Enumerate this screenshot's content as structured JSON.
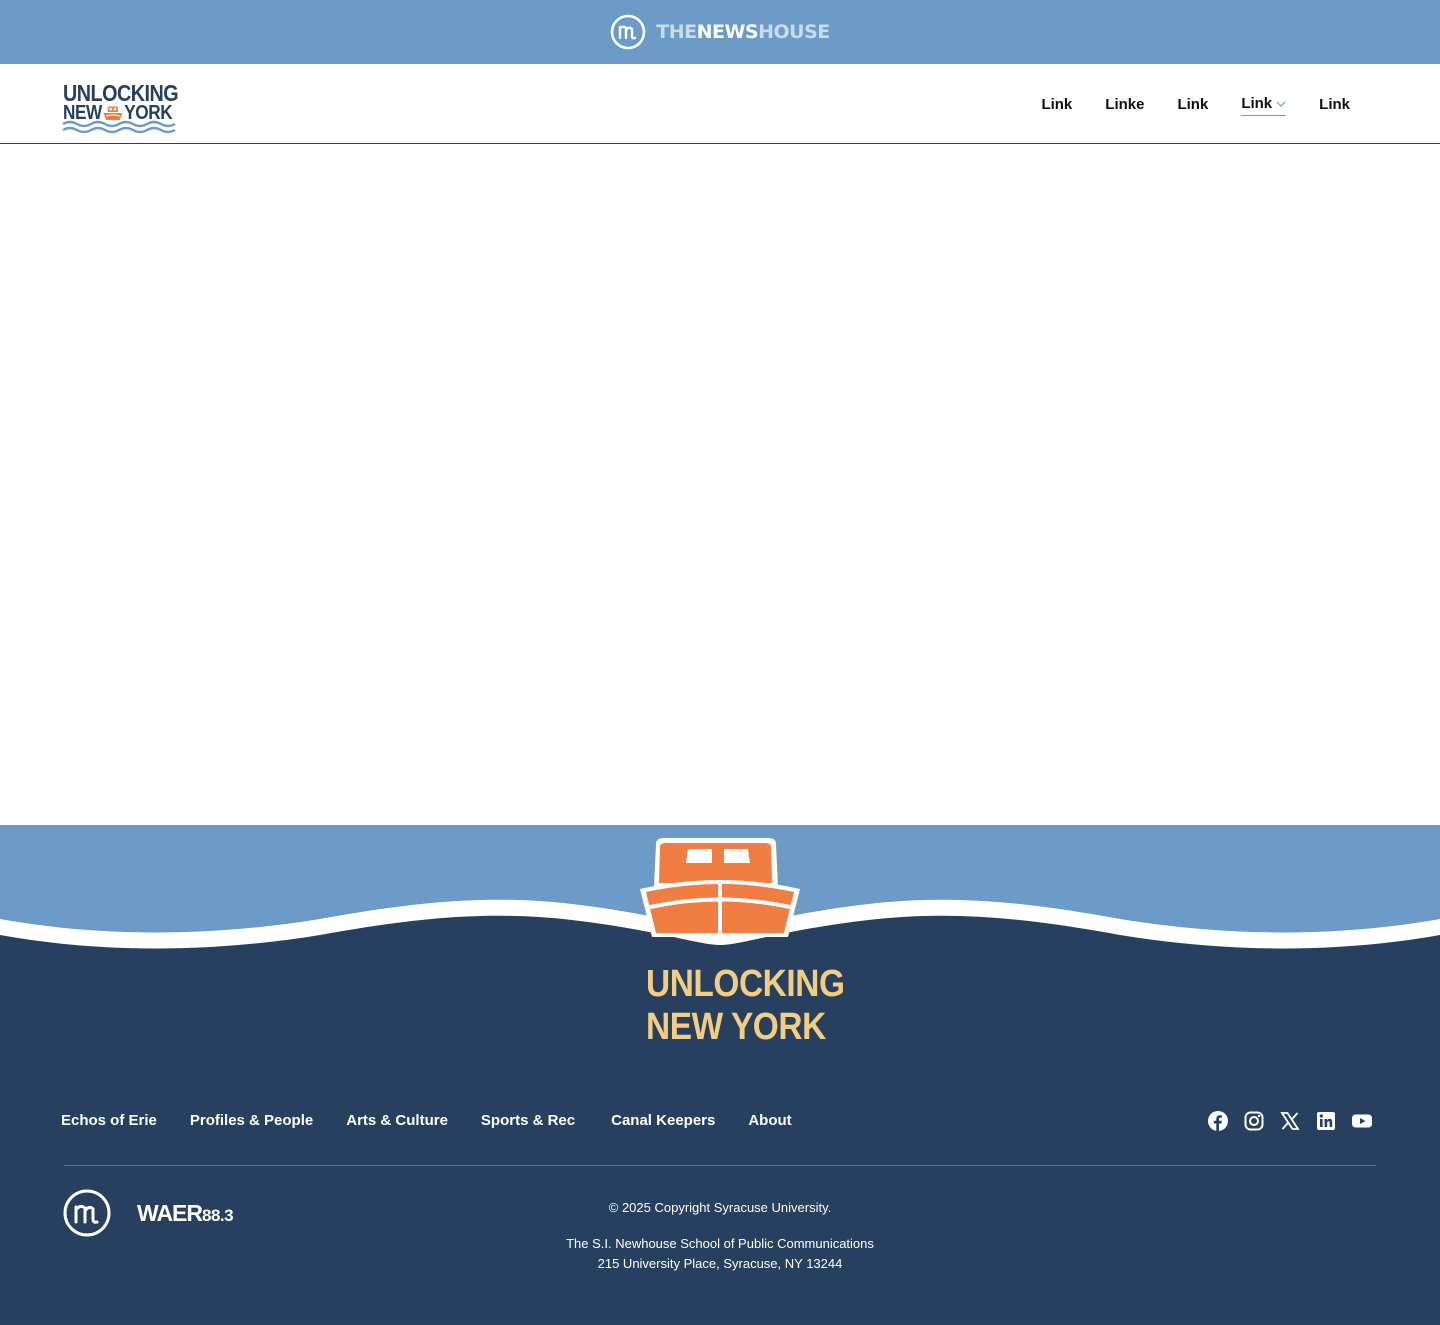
{
  "topbar": {
    "brand_the": "THE",
    "brand_news": "NEWS",
    "brand_house": "HOUSE",
    "icon": "newshouse-nh-circle-icon",
    "bg_color": "#6b9bc6"
  },
  "header": {
    "logo": {
      "line1": "UNLOCKING",
      "line2_left": "NEW",
      "line2_right": "YORK",
      "icons": [
        "boat-icon",
        "waves-icon"
      ]
    },
    "nav": [
      {
        "label": "Link",
        "active": false
      },
      {
        "label": "Linke",
        "active": false
      },
      {
        "label": "Link",
        "active": false
      },
      {
        "label": "Link",
        "active": true,
        "has_dropdown": true
      },
      {
        "label": "Link",
        "active": false
      }
    ]
  },
  "footer": {
    "title_line1": "UNLOCKING",
    "title_line2": "NEW YORK",
    "nav": [
      {
        "label": "Echos of Erie"
      },
      {
        "label": "Profiles & People"
      },
      {
        "label": "Arts & Culture"
      },
      {
        "label": "Sports & Rec"
      },
      {
        "label": "Canal Keepers"
      },
      {
        "label": "About"
      }
    ],
    "social": [
      "facebook-icon",
      "instagram-icon",
      "x-icon",
      "linkedin-icon",
      "youtube-icon"
    ],
    "waer_main": "WAER",
    "waer_freq": "88.3",
    "copyright": "© 2025 Copyright Syracuse University.",
    "school_line1": "The S.I. Newhouse School of Public Communications",
    "school_line2": "215 University Place, Syracuse, NY 13244",
    "colors": {
      "bg": "#27405f",
      "title": "#f4cd82",
      "sky": "#6b9bc6",
      "boat": "#f07d41"
    }
  }
}
